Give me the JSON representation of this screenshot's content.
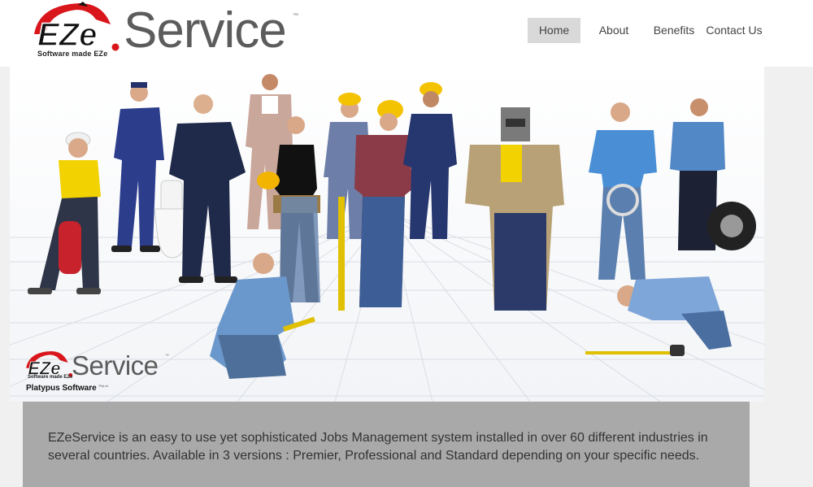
{
  "brand": {
    "logo_mark": "EZe",
    "logo_word": "Service",
    "tagline": "Software made EZe",
    "trademark": "™"
  },
  "nav": {
    "items": [
      {
        "label": "Home",
        "active": true
      },
      {
        "label": "About",
        "active": false
      },
      {
        "label": "Benefits",
        "active": false
      },
      {
        "label": "Contact Us",
        "active": false
      }
    ]
  },
  "hero": {
    "image": "group-of-tradespeople-workers",
    "overlay_logo": {
      "mark": "EZe",
      "word": "Service",
      "tagline": "Software made EZe",
      "trademark": "™",
      "company": "Platypus Software",
      "company_tm": "PtyLtd"
    }
  },
  "description": {
    "text": "EZeService is an easy to use yet sophisticated Jobs Management system installed in over 60 different industries in several countries. Available in 3 versions : Premier, Professional and Standard depending on your specific needs."
  },
  "colors": {
    "brand_red": "#d8161b",
    "logo_grey": "#5c5c5c",
    "nav_active": "#d9d9d9",
    "description_bg": "#a9a9a9"
  }
}
